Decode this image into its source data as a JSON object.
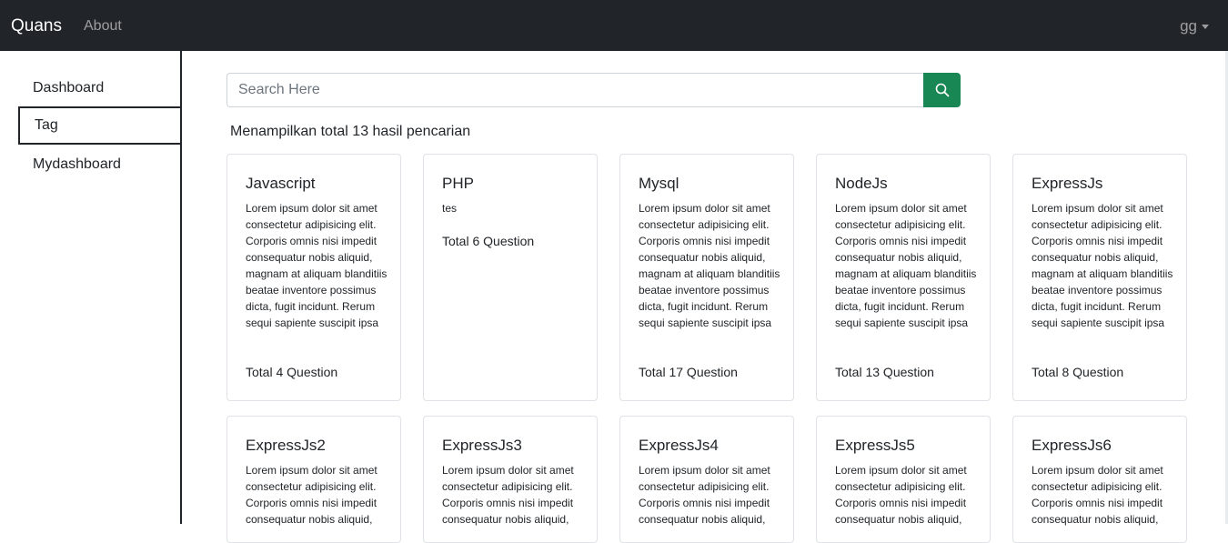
{
  "navbar": {
    "brand": "Quans",
    "about": "About",
    "user": "gg"
  },
  "sidebar": {
    "items": [
      {
        "label": "Dashboard"
      },
      {
        "label": "Tag",
        "active": true
      },
      {
        "label": "Mydashboard"
      }
    ]
  },
  "search": {
    "placeholder": "Search Here",
    "button_icon": "search-icon",
    "button_color": "#198754"
  },
  "results": {
    "summary": "Menampilkan total 13 hasil pencarian"
  },
  "tags": [
    {
      "name": "Javascript",
      "description": "Lorem ipsum dolor sit amet consectetur adipisicing elit. Corporis omnis nisi impedit consequatur nobis aliquid, magnam at aliquam blanditiis beatae inventore possimus dicta, fugit incidunt. Rerum sequi sapiente suscipit ipsa",
      "total": "Total 4 Question"
    },
    {
      "name": "PHP",
      "description": "tes",
      "total": "Total 6 Question"
    },
    {
      "name": "Mysql",
      "description": "Lorem ipsum dolor sit amet consectetur adipisicing elit. Corporis omnis nisi impedit consequatur nobis aliquid, magnam at aliquam blanditiis beatae inventore possimus dicta, fugit incidunt. Rerum sequi sapiente suscipit ipsa",
      "total": "Total 17 Question"
    },
    {
      "name": "NodeJs",
      "description": "Lorem ipsum dolor sit amet consectetur adipisicing elit. Corporis omnis nisi impedit consequatur nobis aliquid, magnam at aliquam blanditiis beatae inventore possimus dicta, fugit incidunt. Rerum sequi sapiente suscipit ipsa",
      "total": "Total 13 Question"
    },
    {
      "name": "ExpressJs",
      "description": "Lorem ipsum dolor sit amet consectetur adipisicing elit. Corporis omnis nisi impedit consequatur nobis aliquid, magnam at aliquam blanditiis beatae inventore possimus dicta, fugit incidunt. Rerum sequi sapiente suscipit ipsa",
      "total": "Total 8 Question"
    },
    {
      "name": "ExpressJs2",
      "description": "Lorem ipsum dolor sit amet consectetur adipisicing elit. Corporis omnis nisi impedit consequatur nobis aliquid,"
    },
    {
      "name": "ExpressJs3",
      "description": "Lorem ipsum dolor sit amet consectetur adipisicing elit. Corporis omnis nisi impedit consequatur nobis aliquid,"
    },
    {
      "name": "ExpressJs4",
      "description": "Lorem ipsum dolor sit amet consectetur adipisicing elit. Corporis omnis nisi impedit consequatur nobis aliquid,"
    },
    {
      "name": "ExpressJs5",
      "description": "Lorem ipsum dolor sit amet consectetur adipisicing elit. Corporis omnis nisi impedit consequatur nobis aliquid,"
    },
    {
      "name": "ExpressJs6",
      "description": "Lorem ipsum dolor sit amet consectetur adipisicing elit. Corporis omnis nisi impedit consequatur nobis aliquid,"
    }
  ]
}
